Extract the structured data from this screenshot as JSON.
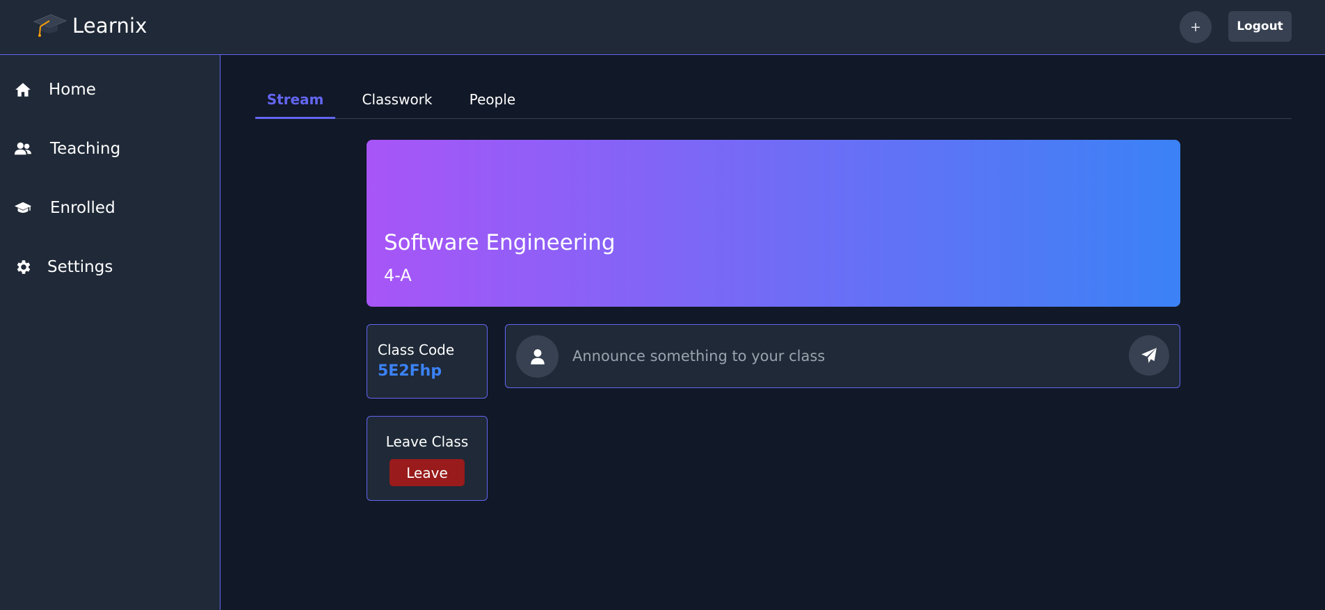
{
  "header": {
    "brand_name": "Learnix",
    "brand_icon": "graduation-cap-icon",
    "add_label": "+",
    "logout_label": "Logout"
  },
  "sidebar": {
    "items": [
      {
        "label": "Home",
        "icon": "home-icon"
      },
      {
        "label": "Teaching",
        "icon": "users-icon"
      },
      {
        "label": "Enrolled",
        "icon": "graduation-cap-icon"
      },
      {
        "label": "Settings",
        "icon": "gear-icon"
      }
    ]
  },
  "tabs": [
    {
      "label": "Stream",
      "active": true
    },
    {
      "label": "Classwork",
      "active": false
    },
    {
      "label": "People",
      "active": false
    }
  ],
  "banner": {
    "title": "Software Engineering",
    "section": "4-A",
    "gradient_start": "#a855f7",
    "gradient_end": "#3b82f6"
  },
  "class_code": {
    "label": "Class Code",
    "value": "5E2Fhp"
  },
  "leave": {
    "label": "Leave Class",
    "button_label": "Leave"
  },
  "announce": {
    "placeholder": "Announce something to your class",
    "avatar_icon": "user-icon",
    "send_icon": "send-icon"
  },
  "colors": {
    "accent": "#6366f1",
    "code_blue": "#3b82f6",
    "danger": "#991b1b",
    "background": "#111827",
    "panel": "#1f2937"
  }
}
